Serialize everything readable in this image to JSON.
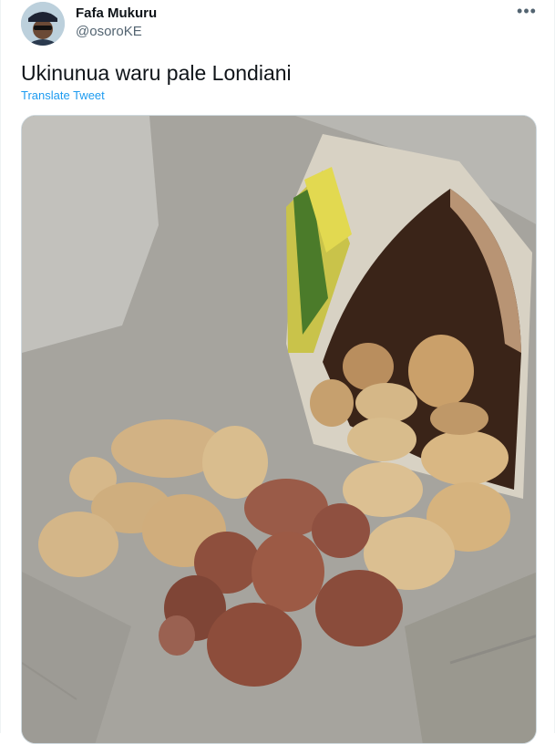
{
  "tweet": {
    "author_name": "Fafa Mukuru",
    "author_handle": "@osoroKE",
    "text": "Ukinunua waru pale Londiani",
    "translate_label": "Translate Tweet",
    "more_icon": "more-dots-icon"
  },
  "media": {
    "kind": "photo"
  },
  "colors": {
    "link": "#1d9bf0",
    "secondary_text": "#536471",
    "primary_text": "#0f1419"
  }
}
